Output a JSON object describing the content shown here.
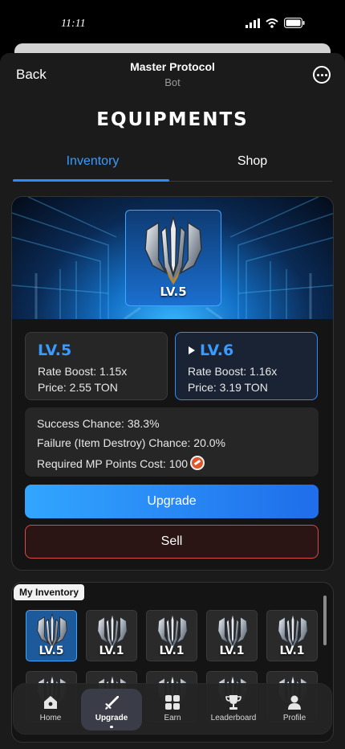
{
  "status_bar": {
    "time": "11:11"
  },
  "header": {
    "back_label": "Back",
    "title": "Master Protocol",
    "subtitle": "Bot"
  },
  "page": {
    "heading": "EQUIPMENTS"
  },
  "tabs": [
    {
      "label": "Inventory",
      "active": true
    },
    {
      "label": "Shop",
      "active": false
    }
  ],
  "upgrade": {
    "item_level": "LV.5",
    "current": {
      "level": "LV.5",
      "rate_boost": "Rate Boost: 1.15x",
      "price": "Price: 2.55 TON"
    },
    "next": {
      "level": "LV.6",
      "rate_boost": "Rate Boost: 1.16x",
      "price": "Price: 3.19 TON"
    },
    "success_chance": "Success Chance: 38.3%",
    "failure_chance": "Failure (Item Destroy) Chance: 20.0%",
    "mp_cost": "Required MP Points Cost: 100",
    "upgrade_label": "Upgrade",
    "sell_label": "Sell"
  },
  "inventory": {
    "label": "My Inventory",
    "items": [
      "LV.5",
      "LV.1",
      "LV.1",
      "LV.1",
      "LV.1"
    ]
  },
  "nav": [
    {
      "label": "Home",
      "icon": "home-icon",
      "active": false
    },
    {
      "label": "Upgrade",
      "icon": "sword-icon",
      "active": true
    },
    {
      "label": "Earn",
      "icon": "grid-icon",
      "active": false
    },
    {
      "label": "Leaderboard",
      "icon": "trophy-icon",
      "active": false
    },
    {
      "label": "Profile",
      "icon": "person-icon",
      "active": false
    }
  ],
  "colors": {
    "accent": "#2a8cff",
    "danger": "#d94a4a",
    "background": "#1b1b1b"
  }
}
